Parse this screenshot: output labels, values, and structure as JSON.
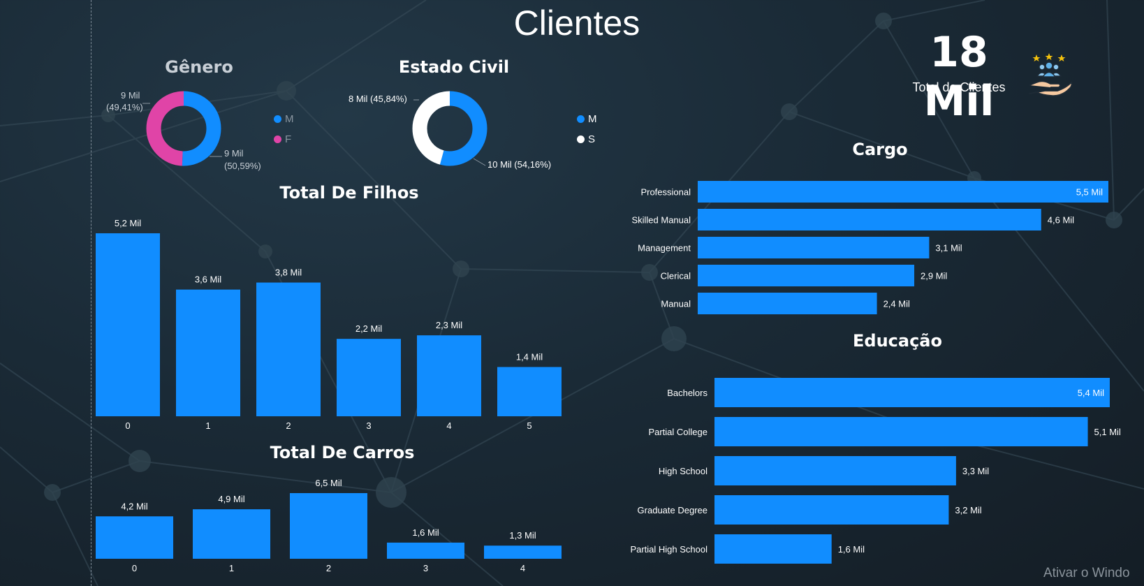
{
  "page": {
    "title": "Clientes",
    "watermark": "Ativar o Windo"
  },
  "kpi": {
    "value": "18 Mil",
    "label": "Total de Clientes",
    "icon": "customers-hand-icon"
  },
  "colors": {
    "blue": "#118DFF",
    "pink": "#E044A7",
    "white": "#FFFFFF"
  },
  "genero": {
    "title": "Gênero",
    "label_top_line1": "9 Mil",
    "label_top_line2": "(49,41%)",
    "label_bottom_line1": "9 Mil",
    "label_bottom_line2": "(50,59%)",
    "legend": [
      {
        "label": "M"
      },
      {
        "label": "F"
      }
    ]
  },
  "estado_civil": {
    "title": "Estado Civil",
    "label_left": "8 Mil (45,84%)",
    "label_right": "10 Mil (54,16%)",
    "legend": [
      {
        "label": "M"
      },
      {
        "label": "S"
      }
    ]
  },
  "chart_data": [
    {
      "id": "genero",
      "type": "pie",
      "title": "Gênero",
      "slices": [
        {
          "label": "M",
          "value": 9,
          "percent": 50.59,
          "display": "9 Mil (50,59%)",
          "color": "#118DFF"
        },
        {
          "label": "F",
          "value": 9,
          "percent": 49.41,
          "display": "9 Mil (49,41%)",
          "color": "#E044A7"
        }
      ]
    },
    {
      "id": "estado_civil",
      "type": "pie",
      "title": "Estado Civil",
      "slices": [
        {
          "label": "M",
          "value": 10,
          "percent": 54.16,
          "display": "10 Mil (54,16%)",
          "color": "#118DFF"
        },
        {
          "label": "S",
          "value": 8,
          "percent": 45.84,
          "display": "8 Mil (45,84%)",
          "color": "#FFFFFF"
        }
      ]
    },
    {
      "id": "filhos",
      "type": "bar",
      "title": "Total De Filhos",
      "categories": [
        "0",
        "1",
        "2",
        "3",
        "4",
        "5"
      ],
      "values": [
        5.2,
        3.6,
        3.8,
        2.2,
        2.3,
        1.4
      ],
      "labels": [
        "5,2 Mil",
        "3,6 Mil",
        "3,8 Mil",
        "2,2 Mil",
        "2,3 Mil",
        "1,4 Mil"
      ]
    },
    {
      "id": "carros",
      "type": "bar",
      "title": "Total De Carros",
      "categories": [
        "0",
        "1",
        "2",
        "3",
        "4"
      ],
      "values": [
        4.2,
        4.9,
        6.5,
        1.6,
        1.3
      ],
      "labels": [
        "4,2 Mil",
        "4,9 Mil",
        "6,5 Mil",
        "1,6 Mil",
        "1,3 Mil"
      ]
    },
    {
      "id": "cargo",
      "type": "bar",
      "orientation": "horizontal",
      "title": "Cargo",
      "categories": [
        "Professional",
        "Skilled Manual",
        "Management",
        "Clerical",
        "Manual"
      ],
      "values": [
        5.5,
        4.6,
        3.1,
        2.9,
        2.4
      ],
      "labels": [
        "5,5 Mil",
        "4,6 Mil",
        "3,1 Mil",
        "2,9 Mil",
        "2,4 Mil"
      ]
    },
    {
      "id": "educacao",
      "type": "bar",
      "orientation": "horizontal",
      "title": "Educação",
      "categories": [
        "Bachelors",
        "Partial College",
        "High School",
        "Graduate Degree",
        "Partial High School"
      ],
      "values": [
        5.4,
        5.1,
        3.3,
        3.2,
        1.6
      ],
      "labels": [
        "5,4 Mil",
        "5,1 Mil",
        "3,3 Mil",
        "3,2 Mil",
        "1,6 Mil"
      ]
    }
  ]
}
